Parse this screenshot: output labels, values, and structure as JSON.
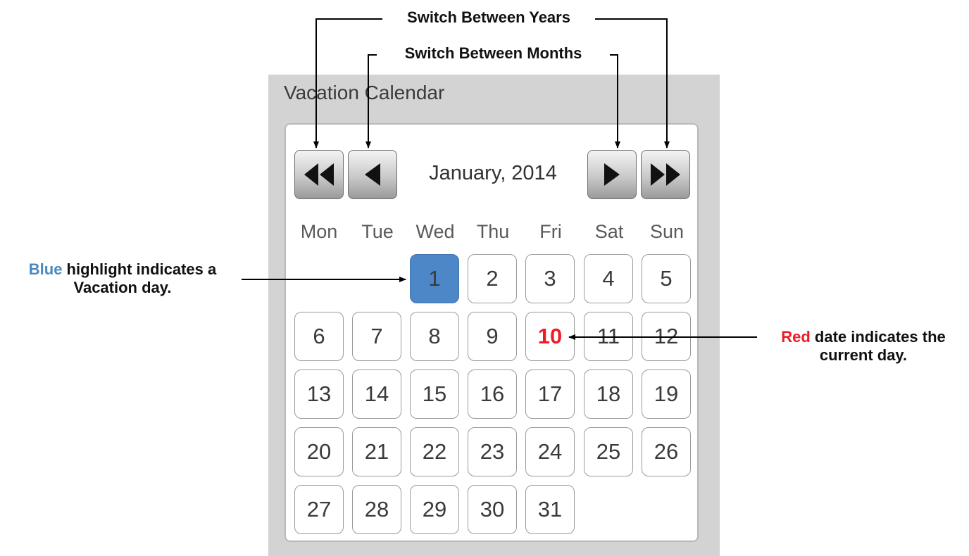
{
  "panel": {
    "title": "Vacation Calendar"
  },
  "calendar": {
    "month_label": "January, 2014",
    "weekdays": [
      "Mon",
      "Tue",
      "Wed",
      "Thu",
      "Fri",
      "Sat",
      "Sun"
    ],
    "first_weekday_index": 2,
    "days": [
      "1",
      "2",
      "3",
      "4",
      "5",
      "6",
      "7",
      "8",
      "9",
      "10",
      "11",
      "12",
      "13",
      "14",
      "15",
      "16",
      "17",
      "18",
      "19",
      "20",
      "21",
      "22",
      "23",
      "24",
      "25",
      "26",
      "27",
      "28",
      "29",
      "30",
      "31"
    ],
    "vacation_day": "1",
    "current_day": "10"
  },
  "nav": {
    "prev_year_icon": "double-left-arrow-icon",
    "prev_month_icon": "left-arrow-icon",
    "next_month_icon": "right-arrow-icon",
    "next_year_icon": "double-right-arrow-icon"
  },
  "annotations": {
    "years": "Switch Between Years",
    "months": "Switch Between Months",
    "blue_keyword": "Blue",
    "blue_rest_line1": " highlight indicates a",
    "blue_line2": "Vacation day.",
    "red_keyword": "Red",
    "red_rest_line1": " date indicates the",
    "red_line2": "current day."
  },
  "colors": {
    "panel_bg": "#d3d3d3",
    "vacation_highlight": "#4d87c8",
    "current_day_text": "#ee1c25",
    "blue_keyword": "#4a88c0",
    "red_keyword": "#ee1c25"
  }
}
